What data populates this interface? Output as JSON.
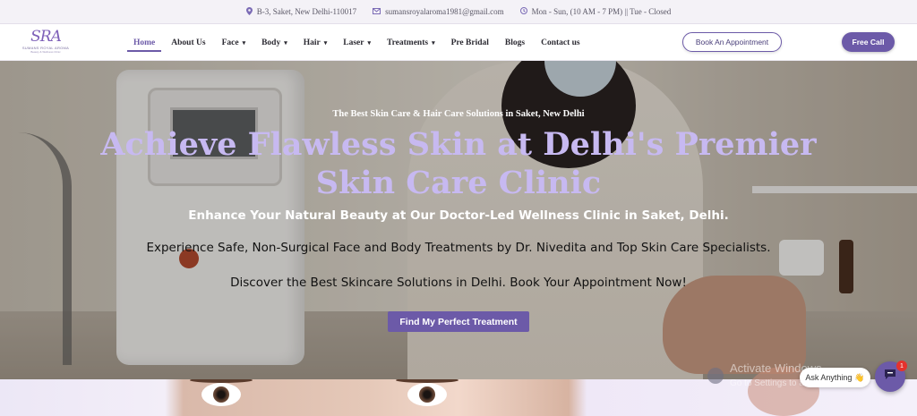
{
  "topbar": {
    "address": "B-3, Saket, New Delhi-110017",
    "email": "sumansroyalaroma1981@gmail.com",
    "hours": "Mon - Sun, (10 AM - 7 PM) || Tue - Closed",
    "icons": [
      "map-pin-icon",
      "envelope-icon",
      "clock-icon"
    ]
  },
  "logo": {
    "mark": "SRA",
    "name": "SUMANS ROYAL AROMA",
    "tagline": "Beauty & Wellness Clinic"
  },
  "nav": {
    "items": [
      {
        "label": "Home",
        "active": true,
        "dropdown": false
      },
      {
        "label": "About Us",
        "active": false,
        "dropdown": false
      },
      {
        "label": "Face",
        "active": false,
        "dropdown": true
      },
      {
        "label": "Body",
        "active": false,
        "dropdown": true
      },
      {
        "label": "Hair",
        "active": false,
        "dropdown": true
      },
      {
        "label": "Laser",
        "active": false,
        "dropdown": true
      },
      {
        "label": "Treatments",
        "active": false,
        "dropdown": true
      },
      {
        "label": "Pre Bridal",
        "active": false,
        "dropdown": false
      },
      {
        "label": "Blogs",
        "active": false,
        "dropdown": false
      },
      {
        "label": "Contact us",
        "active": false,
        "dropdown": false
      }
    ],
    "caret": "▾"
  },
  "header": {
    "appointment_label": "Book An Appointment",
    "call_label": "Free Call"
  },
  "hero": {
    "kicker": "The Best Skin Care & Hair Care Solutions in Saket, New Delhi",
    "headline": "Achieve Flawless Skin at Delhi's Premier Skin Care Clinic",
    "sub1": "Enhance Your Natural Beauty at Our Doctor-Led Wellness Clinic in Saket, Delhi.",
    "sub2": "Experience Safe, Non-Surgical Face and Body Treatments by Dr. Nivedita and Top Skin Care Specialists.",
    "sub3": "Discover the Best Skincare Solutions in Delhi. Book Your Appointment Now!",
    "cta_label": "Find My Perfect Treatment"
  },
  "watermark": {
    "line1": "Activate Windows",
    "line2": "Go to Settings to activate Windows."
  },
  "chat": {
    "bubble_text": "Ask Anything",
    "bubble_emoji": "👋",
    "badge_count": "1"
  },
  "colors": {
    "brand": "#6c5aa8",
    "headline": "#c7b9f1",
    "topbar_bg": "#f4f2f7",
    "badge": "#e5322d"
  }
}
